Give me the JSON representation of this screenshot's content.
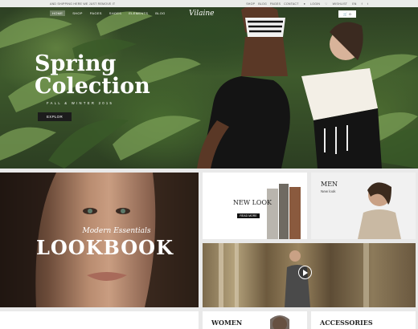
{
  "topbar": {
    "promo": "AND SHIPPING HERE WE JUST REMOVE IT",
    "links": [
      "SHOP",
      "BLOG",
      "PAGES",
      "CONTACT"
    ],
    "login": "LOGIN",
    "wishlist": "WISHLIST",
    "lang": "EN"
  },
  "nav": {
    "items": [
      "HOME",
      "SHOP",
      "PAGES",
      "SHOES",
      "ELEMENTS",
      "BLOG"
    ]
  },
  "logo": "Vilaine",
  "cart": {
    "count": "0"
  },
  "hero": {
    "title_line1": "Spring",
    "title_line2": "Colection",
    "subtitle": "FALL & WINTER 2015",
    "button": "EXPLOR"
  },
  "lookbook": {
    "subtitle": "Modern Essentials",
    "title": "LOOKBOOK"
  },
  "newlook": {
    "title": "NEW LOOK",
    "button": "READ MORE"
  },
  "men": {
    "title": "MEN",
    "subtitle": "New look"
  },
  "women": {
    "title": "WOMEN"
  },
  "accessories": {
    "title": "ACCESSORIES"
  },
  "colors": {
    "accent": "#1c1c1c",
    "foliage": "#476a2f"
  }
}
